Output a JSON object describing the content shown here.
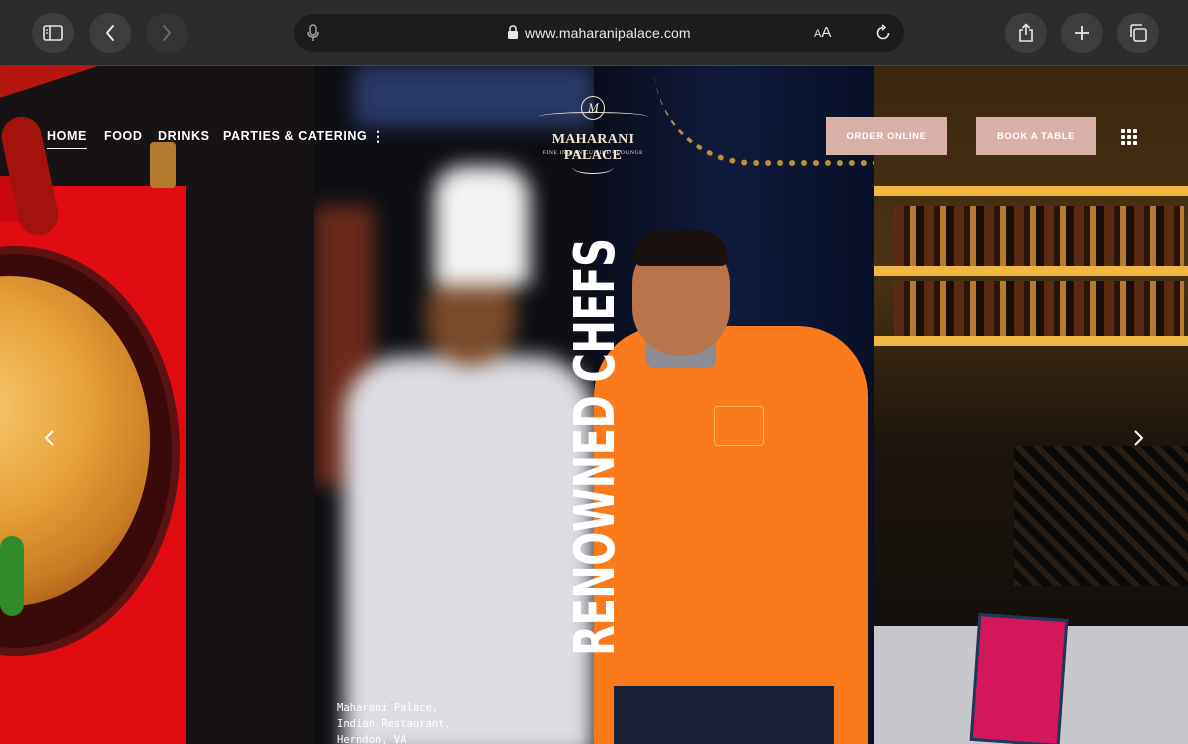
{
  "browser": {
    "url": "www.maharanipalace.com",
    "text_size_label": "AA",
    "icons": [
      "sidebar-icon",
      "back-icon",
      "forward-icon",
      "mic-icon",
      "lock-icon",
      "reload-icon",
      "share-icon",
      "new-tab-icon",
      "tabs-icon"
    ]
  },
  "site": {
    "nav": {
      "home": "HOME",
      "food": "FOOD",
      "drinks": "DRINKS",
      "parties": "PARTIES & CATERING",
      "more": "⋮"
    },
    "logo": {
      "monogram": "M",
      "name": "MAHARANI PALACE",
      "tagline": "FINE INDIAN CUISINE • LOUNGE"
    },
    "buttons": {
      "order_online": "ORDER ONLINE",
      "book_table": "BOOK A TABLE"
    },
    "hero": {
      "headline_part1": "RENOWNED",
      "headline_part2": "CHEFS"
    },
    "address": {
      "line1": "Maharani Palace,",
      "line2": "Indian Restaurant,",
      "line3": "Herndon, VA"
    },
    "colors": {
      "cta_background": "#d8b0a8",
      "chef_jacket": "#fb7a1b"
    }
  }
}
